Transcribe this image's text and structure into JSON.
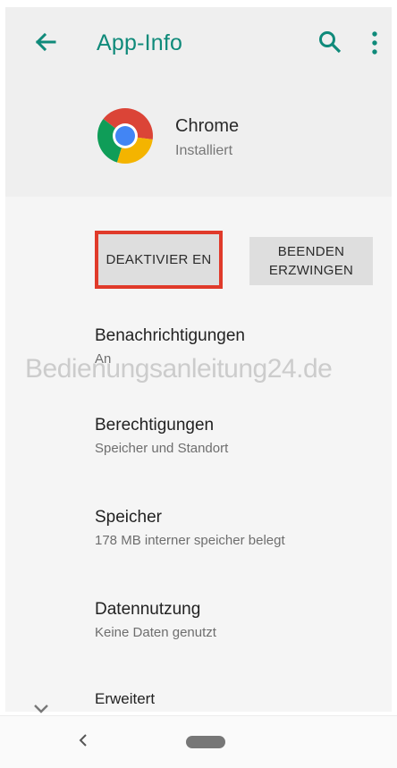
{
  "toolbar": {
    "title": "App-Info",
    "back_icon": "arrow-left-icon",
    "search_icon": "search-icon",
    "menu_icon": "more-vert-icon",
    "accent_color": "#0f8a7a"
  },
  "app": {
    "name": "Chrome",
    "status": "Installiert",
    "icon": "chrome-logo-icon"
  },
  "actions": {
    "deactivate_label": "DEAKTIVIER EN",
    "force_stop_label": "BEENDEN ERZWINGEN",
    "highlight_color": "#e03a2a"
  },
  "settings": [
    {
      "label": "Benachrichtigungen",
      "summary": "An"
    },
    {
      "label": "Berechtigungen",
      "summary": "Speicher und Standort"
    },
    {
      "label": "Speicher",
      "summary": "178 MB interner speicher belegt"
    },
    {
      "label": "Datennutzung",
      "summary": "Keine Daten genutzt"
    },
    {
      "label": "Erweitert",
      "summary": ""
    }
  ],
  "watermark": "Bedienungsanleitung24.de",
  "navbar": {
    "back_icon": "nav-back-icon",
    "home_icon": "nav-home-pill-icon"
  }
}
